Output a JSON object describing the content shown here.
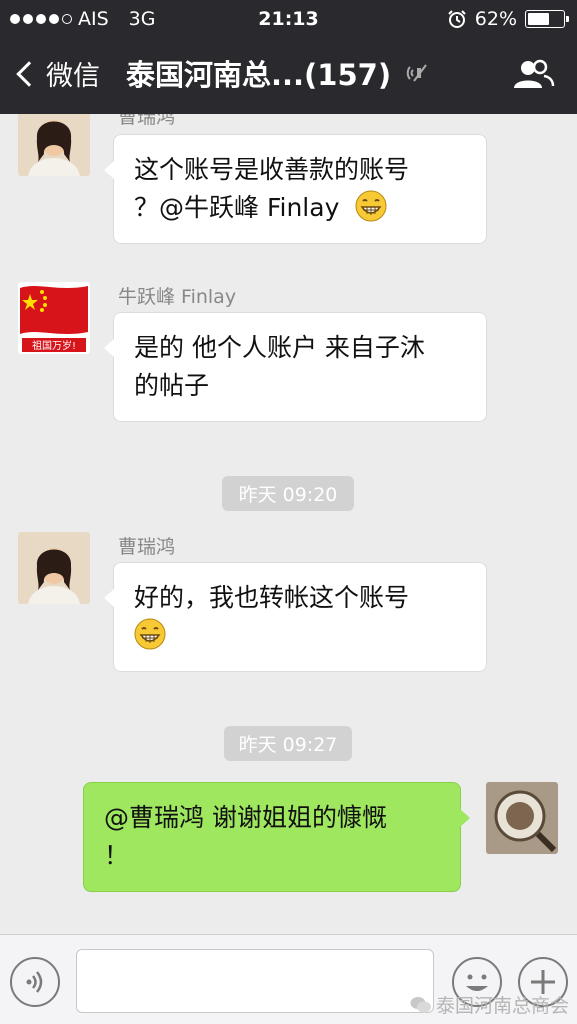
{
  "status_bar": {
    "carrier": "AIS",
    "network": "3G",
    "time": "21:13",
    "battery": "62%",
    "battery_level": 0.62
  },
  "nav": {
    "back_label": "微信",
    "title": "泰国河南总...(157)"
  },
  "messages": [
    {
      "sender": "曹瑞鸿",
      "lines": [
        "这个账号是收善款的账号",
        "？@牛跃峰 Finlay"
      ],
      "emoji": true
    },
    {
      "sender": "牛跃峰 Finlay",
      "lines": [
        "是的 他个人账户 来自子沐",
        "的帖子"
      ],
      "emoji": false,
      "avatar_text": "祖国万岁!"
    },
    {
      "sender": "曹瑞鸿",
      "lines": [
        "好的，我也转帐这个账号",
        ""
      ],
      "emoji": true
    },
    {
      "sender": "",
      "lines": [
        "@曹瑞鸿 谢谢姐姐的慷慨",
        "！"
      ],
      "emoji": false
    }
  ],
  "time_separators": [
    "昨天 09:20",
    "昨天 09:27"
  ],
  "watermark": "泰国河南总商会",
  "colors": {
    "bar": "#2a2a2e",
    "chat_bg": "#ececec",
    "sent_bubble": "#9ee75f",
    "received_bubble": "#ffffff"
  }
}
